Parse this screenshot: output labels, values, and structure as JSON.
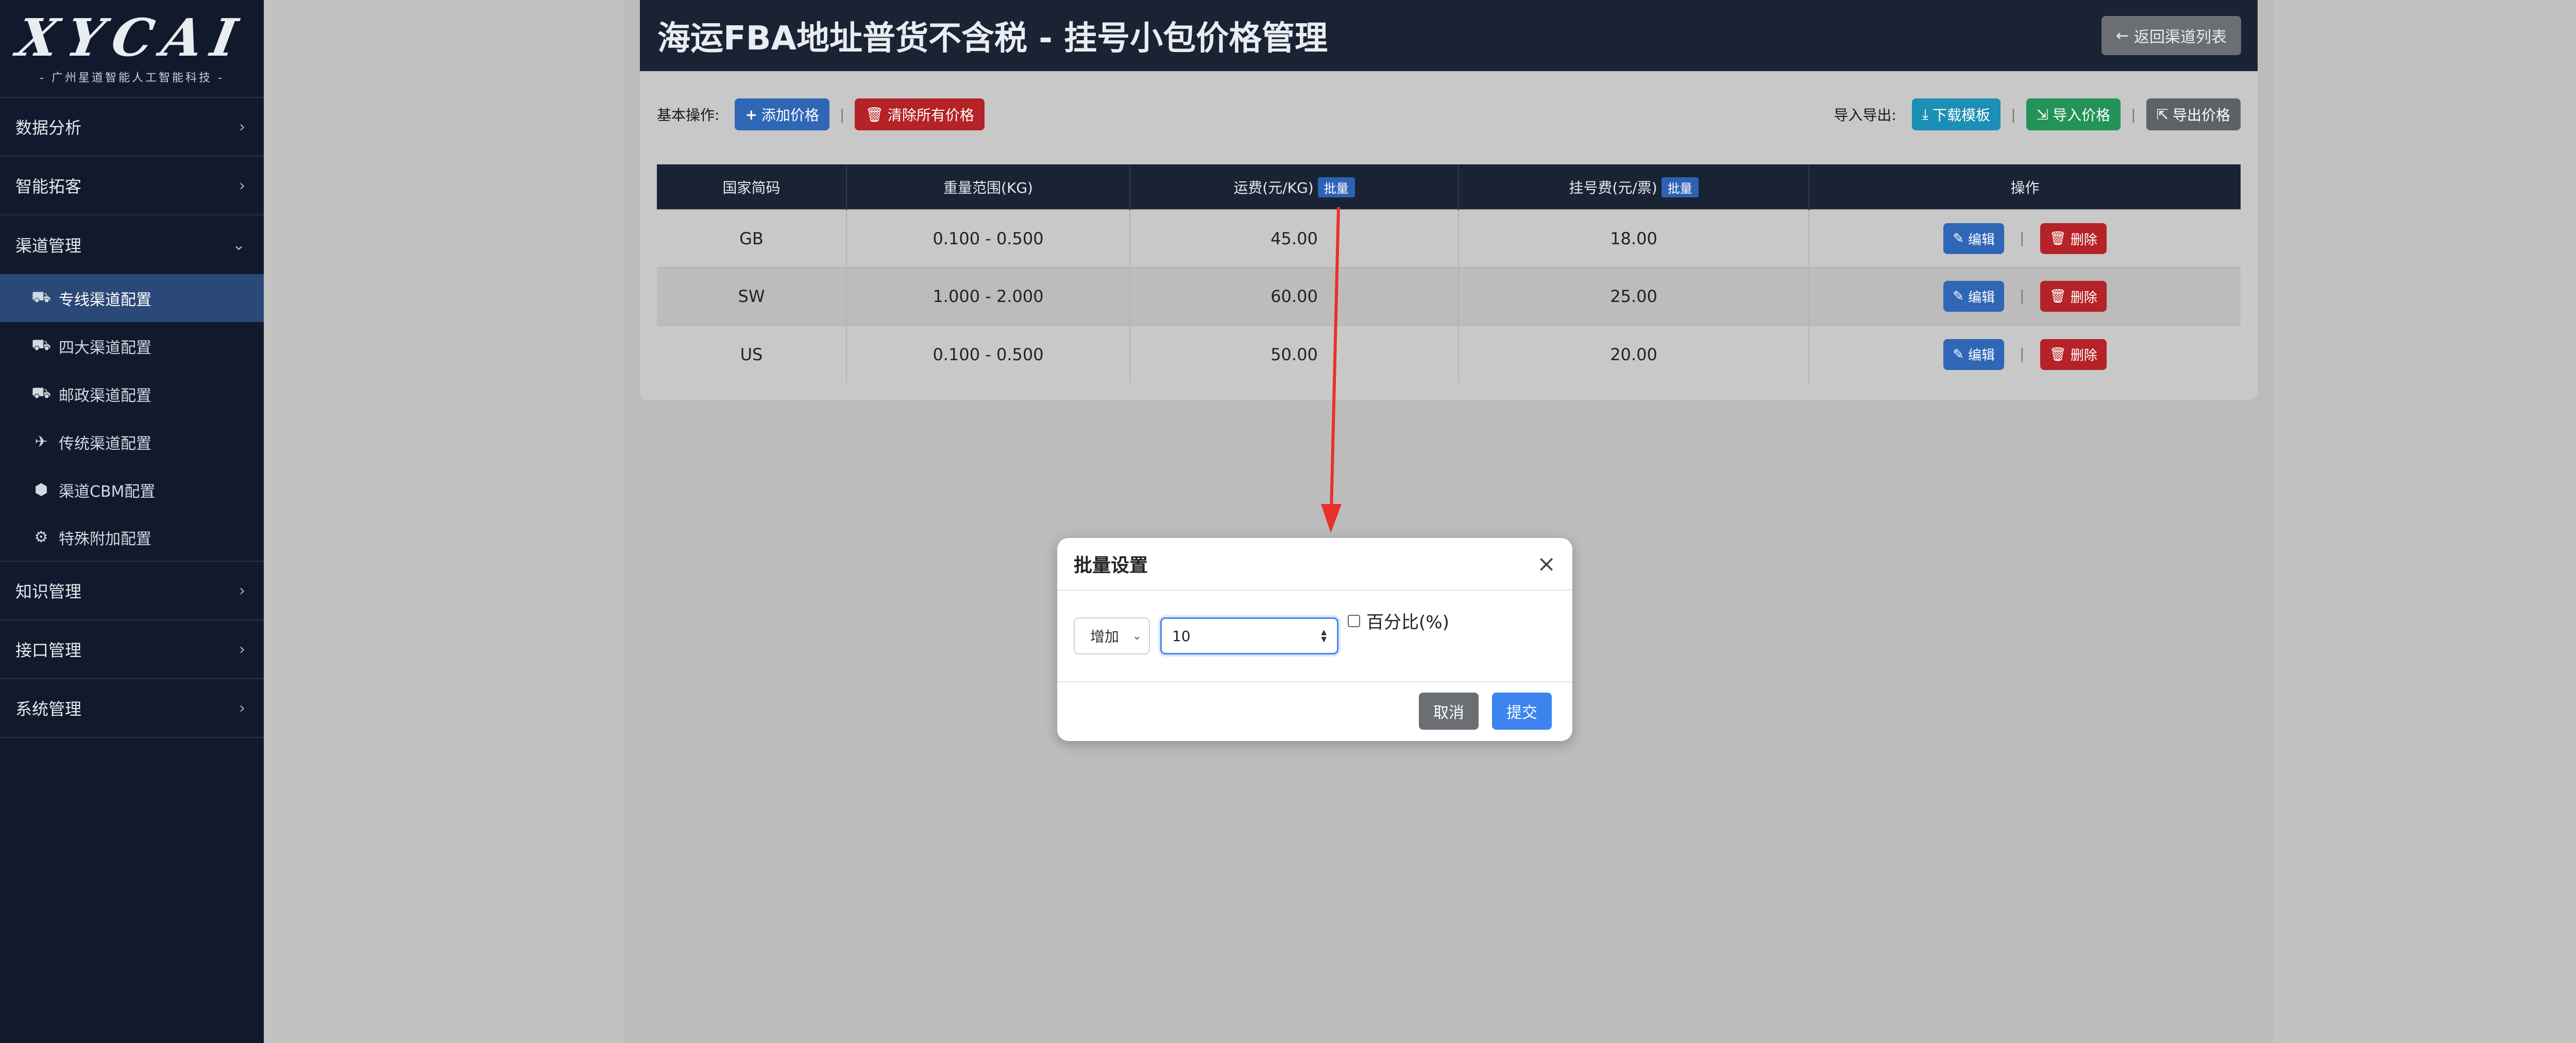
{
  "sidebar": {
    "logo_text": "XYCAI",
    "logo_subtitle": "- 广州星道智能人工智能科技 -",
    "menus": [
      {
        "label": "数据分析",
        "expanded": false
      },
      {
        "label": "智能拓客",
        "expanded": false
      },
      {
        "label": "渠道管理",
        "expanded": true
      }
    ],
    "sub_items": [
      {
        "label": "专线渠道配置",
        "icon": "truck-icon",
        "active": true
      },
      {
        "label": "四大渠道配置",
        "icon": "truck-icon",
        "active": false
      },
      {
        "label": "邮政渠道配置",
        "icon": "truck-icon",
        "active": false
      },
      {
        "label": "传统渠道配置",
        "icon": "plane-icon",
        "active": false
      },
      {
        "label": "渠道CBM配置",
        "icon": "cube-icon",
        "active": false
      },
      {
        "label": "特殊附加配置",
        "icon": "gear-icon",
        "active": false
      }
    ],
    "menus_after": [
      {
        "label": "知识管理"
      },
      {
        "label": "接口管理"
      },
      {
        "label": "系统管理"
      }
    ]
  },
  "header": {
    "title": "海运FBA地址普货不含税 - 挂号小包价格管理",
    "back_button": "返回渠道列表"
  },
  "toolbar": {
    "basic_label": "基本操作:",
    "add_price": "添加价格",
    "clear_all": "清除所有价格",
    "import_export_label": "导入导出:",
    "download_template": "下载模板",
    "import_price": "导入价格",
    "export_price": "导出价格"
  },
  "table": {
    "headers": [
      "国家简码",
      "重量范围(KG)",
      "运费(元/KG)",
      "挂号费(元/票)",
      "操作"
    ],
    "batch_badge": "批量",
    "edit_label": "编辑",
    "delete_label": "删除",
    "rows": [
      {
        "country": "GB",
        "weight": "0.100 - 0.500",
        "freight": "45.00",
        "reg_fee": "18.00"
      },
      {
        "country": "SW",
        "weight": "1.000 - 2.000",
        "freight": "60.00",
        "reg_fee": "25.00"
      },
      {
        "country": "US",
        "weight": "0.100 - 0.500",
        "freight": "50.00",
        "reg_fee": "20.00"
      }
    ]
  },
  "modal": {
    "title": "批量设置",
    "close": "×",
    "operation_select": "增加",
    "amount_value": "10",
    "percent_label": "百分比(%)",
    "percent_checked": false,
    "cancel": "取消",
    "submit": "提交"
  },
  "colors": {
    "sidebar_bg": "#111a2c",
    "active_item": "#2a4878",
    "header_bg": "#1a2334",
    "primary": "#2f67b6",
    "danger": "#b52227",
    "info": "#1b8fb5",
    "success": "#239358",
    "arrow": "#e8312a"
  }
}
